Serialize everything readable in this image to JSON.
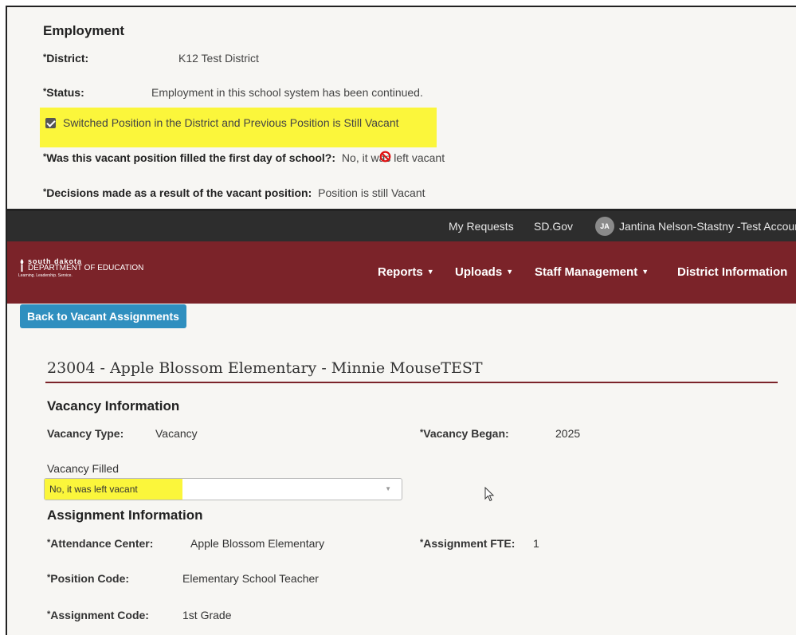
{
  "employment": {
    "title": "Employment",
    "district_label": "District:",
    "district_value": "K12 Test District",
    "status_label": "Status:",
    "status_value": "Employment in this school system has been continued.",
    "switched_label": "Switched Position in the District and Previous Position is Still Vacant",
    "switched_checked": true,
    "filled_first_day_label": "Was this vacant position filled the first day of school?:",
    "filled_first_day_value": "No, it was left vacant",
    "decisions_label": "Decisions made as a result of the vacant position:",
    "decisions_value": "Position is still Vacant",
    "required_mark": "*"
  },
  "topbar": {
    "my_requests": "My Requests",
    "sd_gov": "SD.Gov",
    "avatar_initials": "JA",
    "user_name": "Jantina Nelson-Stastny -Test Accour"
  },
  "logo": {
    "line1": "south dakota",
    "line2": "DEPARTMENT OF EDUCATION",
    "line3": "Learning. Leadership. Service."
  },
  "nav": {
    "reports": "Reports",
    "uploads": "Uploads",
    "staff_management": "Staff Management",
    "district_information": "District Information"
  },
  "content": {
    "back_button": "Back to Vacant Assignments",
    "page_title": "23004 - Apple Blossom Elementary - Minnie MouseTEST",
    "vacancy_info_title": "Vacancy Information",
    "vacancy_type_label": "Vacancy Type:",
    "vacancy_type_value": "Vacancy",
    "vacancy_began_label": "Vacancy Began:",
    "vacancy_began_value": "2025",
    "vacancy_filled_label": "Vacancy Filled",
    "vacancy_filled_value": "No, it was left vacant",
    "assignment_info_title": "Assignment Information",
    "attendance_center_label": "Attendance Center:",
    "attendance_center_value": "Apple Blossom Elementary",
    "assignment_fte_label": "Assignment FTE:",
    "assignment_fte_value": "1",
    "position_code_label": "Position Code:",
    "position_code_value": "Elementary School Teacher",
    "assignment_code_label": "Assignment Code:",
    "assignment_code_value": "1st Grade"
  },
  "colors": {
    "brand_maroon": "#7b2329",
    "button_blue": "#2f8fbf",
    "highlight_yellow": "#fbf63b",
    "topbar_dark": "#2d2d2d"
  }
}
